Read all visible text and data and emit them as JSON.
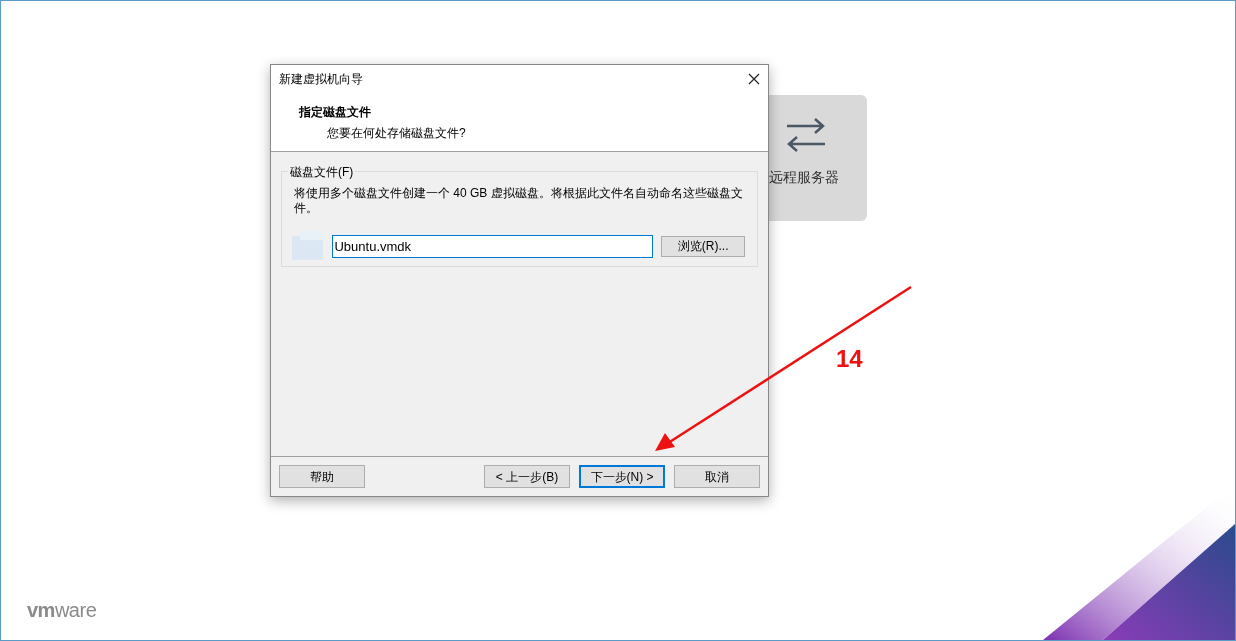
{
  "background": {
    "card": {
      "label": "远程服务器"
    },
    "logo": "**vm**ware"
  },
  "dialog": {
    "title": "新建虚拟机向导",
    "heading": "指定磁盘文件",
    "subheading": "您要在何处存储磁盘文件?",
    "group": {
      "legend": "磁盘文件(F)",
      "description": "将使用多个磁盘文件创建一个 40 GB 虚拟磁盘。将根据此文件名自动命名这些磁盘文件。",
      "file_value": "Ubuntu.vmdk",
      "browse_button": "浏览(R)..."
    },
    "buttons": [
      {
        "label": "帮助",
        "kind": "help",
        "selected": false
      },
      {
        "label": "< 上一步(B)",
        "kind": "nav",
        "selected": false
      },
      {
        "label": "下一步(N) >",
        "kind": "nav",
        "selected": true
      },
      {
        "label": "取消",
        "kind": "nav",
        "selected": false
      }
    ]
  },
  "annotation": {
    "label": "14"
  }
}
